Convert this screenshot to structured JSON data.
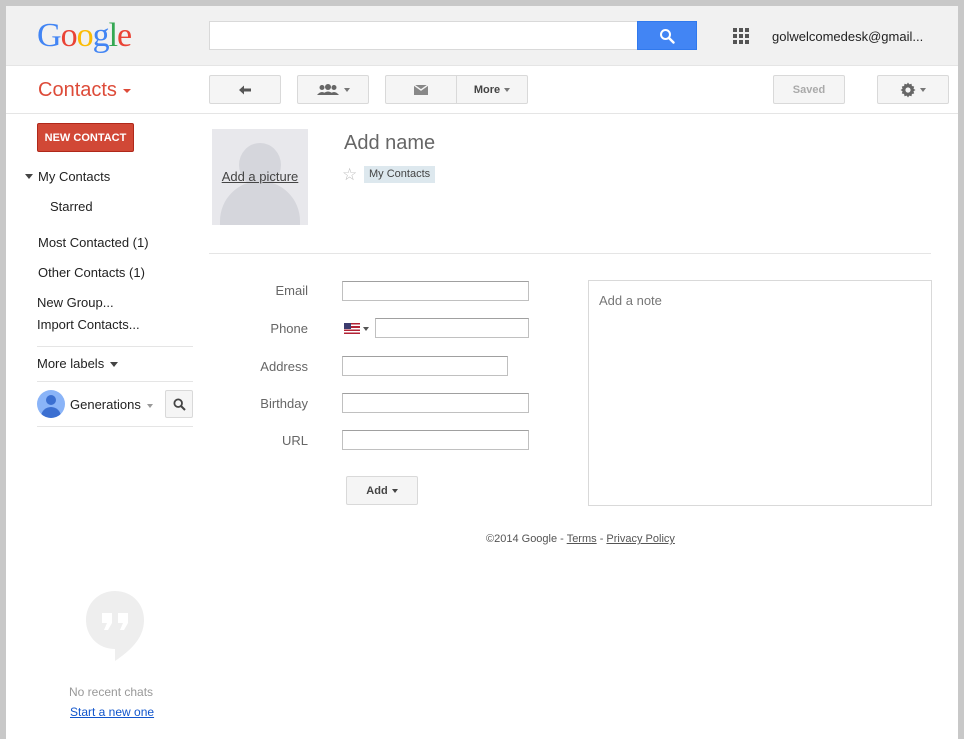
{
  "header": {
    "logo_letters": [
      "G",
      "o",
      "o",
      "g",
      "l",
      "e"
    ],
    "logo_colors": [
      "#4285f4",
      "#ea4335",
      "#fbbc05",
      "#4285f4",
      "#34a853",
      "#ea4335"
    ],
    "search": {
      "value": "",
      "placeholder": ""
    },
    "account": "golwelcomedesk@gmail..."
  },
  "toolbar": {
    "app_title": "Contacts",
    "more_label": "More",
    "saved_label": "Saved",
    "icons": [
      "back-arrow-icon",
      "group-icon",
      "mail-icon",
      "gear-icon"
    ]
  },
  "sidebar": {
    "new_contact": "NEW CONTACT",
    "my_contacts": "My Contacts",
    "starred": "Starred",
    "most_contacted": "Most Contacted (1)",
    "other_contacts": "Other Contacts (1)",
    "new_group": "New Group...",
    "import_contacts": "Import Contacts...",
    "more_labels": "More labels",
    "hangouts_user": "Generations",
    "no_chats": "No recent chats",
    "start_new": "Start a new one"
  },
  "contact": {
    "add_picture": "Add a picture",
    "add_name": "Add name",
    "label_chip": "My Contacts",
    "fields": {
      "email": "Email",
      "phone": "Phone",
      "address": "Address",
      "birthday": "Birthday",
      "url": "URL"
    },
    "values": {
      "email": "",
      "phone": "",
      "address": "",
      "birthday": "",
      "url": ""
    },
    "note_placeholder": "Add a note",
    "add_button": "Add"
  },
  "footer": {
    "copyright": "©2014 Google",
    "sep": " - ",
    "terms": "Terms",
    "privacy": "Privacy Policy"
  },
  "colors": {
    "accent_red": "#dd4b39",
    "search_blue": "#4285f4",
    "link_blue": "#1155cc"
  }
}
